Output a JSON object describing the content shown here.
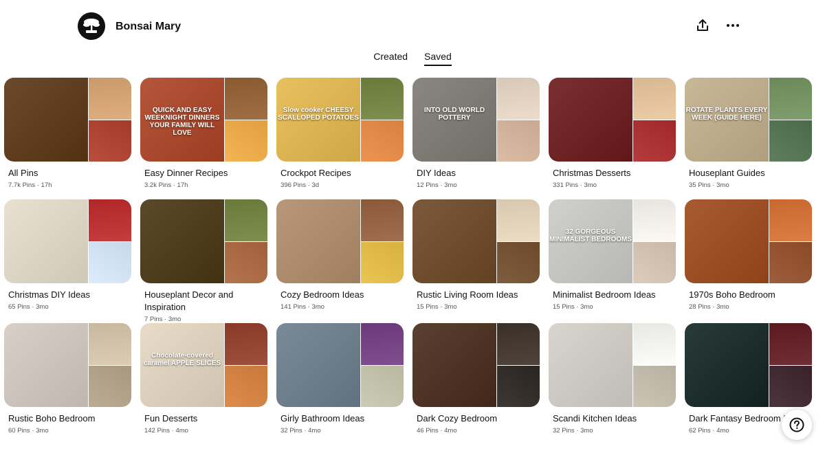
{
  "profile": {
    "name": "Bonsai Mary"
  },
  "header": {
    "share_icon": "share-upload-icon",
    "more_icon": "more-horizontal-icon"
  },
  "tabs": [
    {
      "label": "Created",
      "active": false
    },
    {
      "label": "Saved",
      "active": true
    }
  ],
  "boards": [
    {
      "title": "All Pins",
      "pins": "7.7k Pins",
      "updated": "17h",
      "colors": [
        "#6b4a2b",
        "#c99a6a",
        "#a33a2a"
      ],
      "caption": ""
    },
    {
      "title": "Easy Dinner Recipes",
      "pins": "3.2k Pins",
      "updated": "17h",
      "colors": [
        "#b5553a",
        "#8a5a30",
        "#e0a040"
      ],
      "caption": "QUICK AND EASY WEEKNIGHT DINNERS YOUR FAMILY WILL LOVE"
    },
    {
      "title": "Crockpot Recipes",
      "pins": "396 Pins",
      "updated": "3d",
      "colors": [
        "#e8c060",
        "#6a7a3a",
        "#d88040"
      ],
      "caption": "Slow cooker CHEESY SCALLOPED POTATOES"
    },
    {
      "title": "DIY Ideas",
      "pins": "12 Pins",
      "updated": "3mo",
      "colors": [
        "#8a8680",
        "#d8c8b8",
        "#c8a890"
      ],
      "caption": "INTO OLD WORLD POTTERY"
    },
    {
      "title": "Christmas Desserts",
      "pins": "331 Pins",
      "updated": "3mo",
      "colors": [
        "#7a3030",
        "#d8b890",
        "#a02828"
      ],
      "caption": ""
    },
    {
      "title": "Houseplant Guides",
      "pins": "35 Pins",
      "updated": "3mo",
      "colors": [
        "#c8b898",
        "#6a8a5a",
        "#4a6a4a"
      ],
      "caption": "ROTATE PLANTS EVERY WEEK (GUIDE HERE)"
    },
    {
      "title": "Christmas DIY Ideas",
      "pins": "65 Pins",
      "updated": "3mo",
      "colors": [
        "#e8e0d0",
        "#b02828",
        "#c8d8e8"
      ],
      "caption": ""
    },
    {
      "title": "Houseplant Decor and Inspiration",
      "pins": "7 Pins",
      "updated": "3mo",
      "colors": [
        "#5a4a2a",
        "#6a7a3a",
        "#a0603a"
      ],
      "caption": ""
    },
    {
      "title": "Cozy Bedroom Ideas",
      "pins": "141 Pins",
      "updated": "3mo",
      "colors": [
        "#b89878",
        "#8a5a3a",
        "#d8b040"
      ],
      "caption": ""
    },
    {
      "title": "Rustic Living Room Ideas",
      "pins": "15 Pins",
      "updated": "3mo",
      "colors": [
        "#7a5a3a",
        "#d8c8b0",
        "#6a4a2a"
      ],
      "caption": ""
    },
    {
      "title": "Minimalist Bedroom Ideas",
      "pins": "15 Pins",
      "updated": "3mo",
      "colors": [
        "#d0d0cc",
        "#e8e4e0",
        "#c8b8a8"
      ],
      "caption": "32 GORGEOUS MINIMALIST BEDROOMS"
    },
    {
      "title": "1970s Boho Bedroom",
      "pins": "28 Pins",
      "updated": "3mo",
      "colors": [
        "#a85a30",
        "#c86a30",
        "#8a4a2a"
      ],
      "caption": ""
    },
    {
      "title": "Rustic Boho Bedroom",
      "pins": "60 Pins",
      "updated": "3mo",
      "colors": [
        "#d8d0c8",
        "#c8b8a0",
        "#a89880"
      ],
      "caption": ""
    },
    {
      "title": "Fun Desserts",
      "pins": "142 Pins",
      "updated": "4mo",
      "colors": [
        "#e8dcc8",
        "#8a3a28",
        "#c87838"
      ],
      "caption": "Chocolate-covered caramel APPLE SLICES"
    },
    {
      "title": "Girly Bathroom Ideas",
      "pins": "32 Pins",
      "updated": "4mo",
      "colors": [
        "#7a8a98",
        "#6a3a7a",
        "#b8b8a0"
      ],
      "caption": ""
    },
    {
      "title": "Dark Cozy Bedroom",
      "pins": "46 Pins",
      "updated": "4mo",
      "colors": [
        "#5a4030",
        "#3a3028",
        "#2a2420"
      ],
      "caption": ""
    },
    {
      "title": "Scandi Kitchen Ideas",
      "pins": "32 Pins",
      "updated": "3mo",
      "colors": [
        "#d8d4ce",
        "#e8e8e4",
        "#b8b0a0"
      ],
      "caption": ""
    },
    {
      "title": "Dark Fantasy Bedroom Ideas",
      "pins": "62 Pins",
      "updated": "4mo",
      "colors": [
        "#2a3a38",
        "#5a1a20",
        "#3a2028"
      ],
      "caption": ""
    }
  ],
  "help": {
    "icon": "help-question-icon"
  }
}
